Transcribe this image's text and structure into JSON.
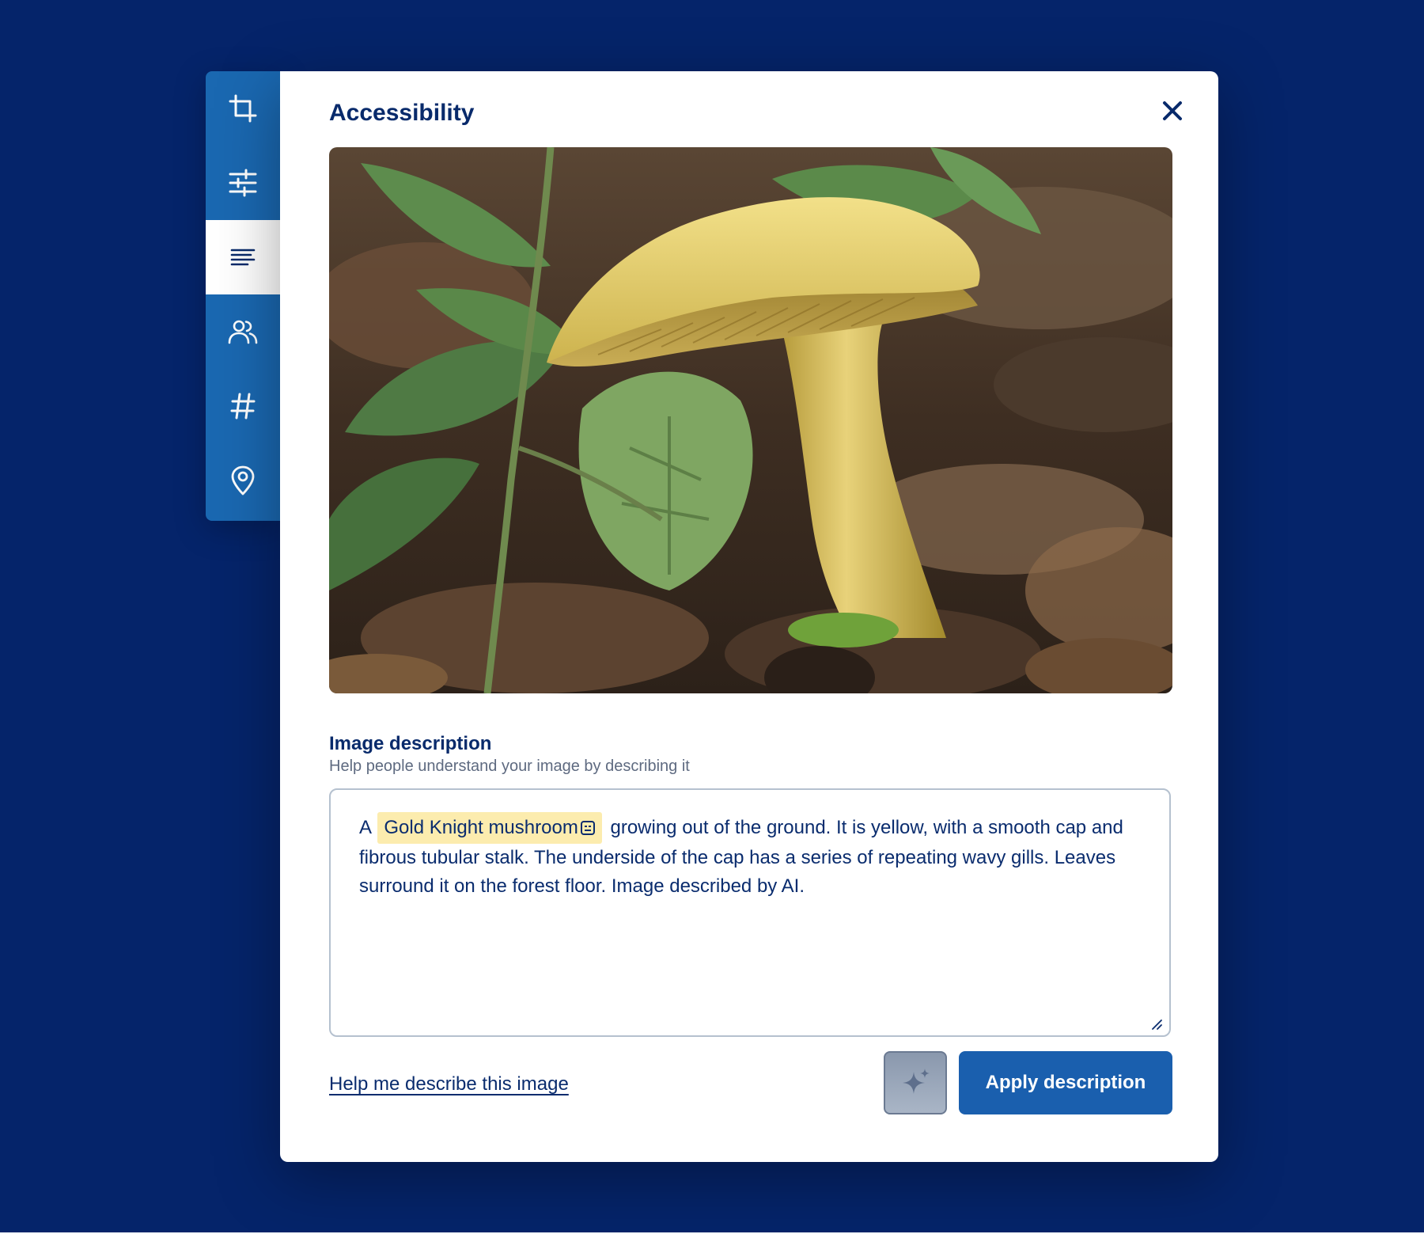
{
  "sidebar": {
    "items": [
      {
        "icon": "crop-icon",
        "active": false
      },
      {
        "icon": "sliders-icon",
        "active": false
      },
      {
        "icon": "text-align-icon",
        "active": true
      },
      {
        "icon": "people-icon",
        "active": false
      },
      {
        "icon": "hashtag-icon",
        "active": false
      },
      {
        "icon": "location-pin-icon",
        "active": false
      }
    ]
  },
  "dialog": {
    "title": "Accessibility",
    "close_icon": "close-icon"
  },
  "image": {
    "subject": "mushroom-photo"
  },
  "description": {
    "title": "Image description",
    "help": "Help people understand your image by describing it",
    "prefix": "A",
    "tag": "Gold Knight mushroom",
    "body": "growing out of the ground. It is yellow, with a smooth cap and fibrous tubular stalk. The underside of the cap has a series of repeating wavy gills. Leaves surround it on the forest floor. Image described by AI."
  },
  "actions": {
    "help_link": "Help me describe this image",
    "ai_icon": "sparkle-icon",
    "apply": "Apply description"
  },
  "colors": {
    "background": "#05246a",
    "sidebar": "#1a68b1",
    "primary": "#1a5fae",
    "text": "#082a6b",
    "tag_highlight": "#fcecae"
  }
}
